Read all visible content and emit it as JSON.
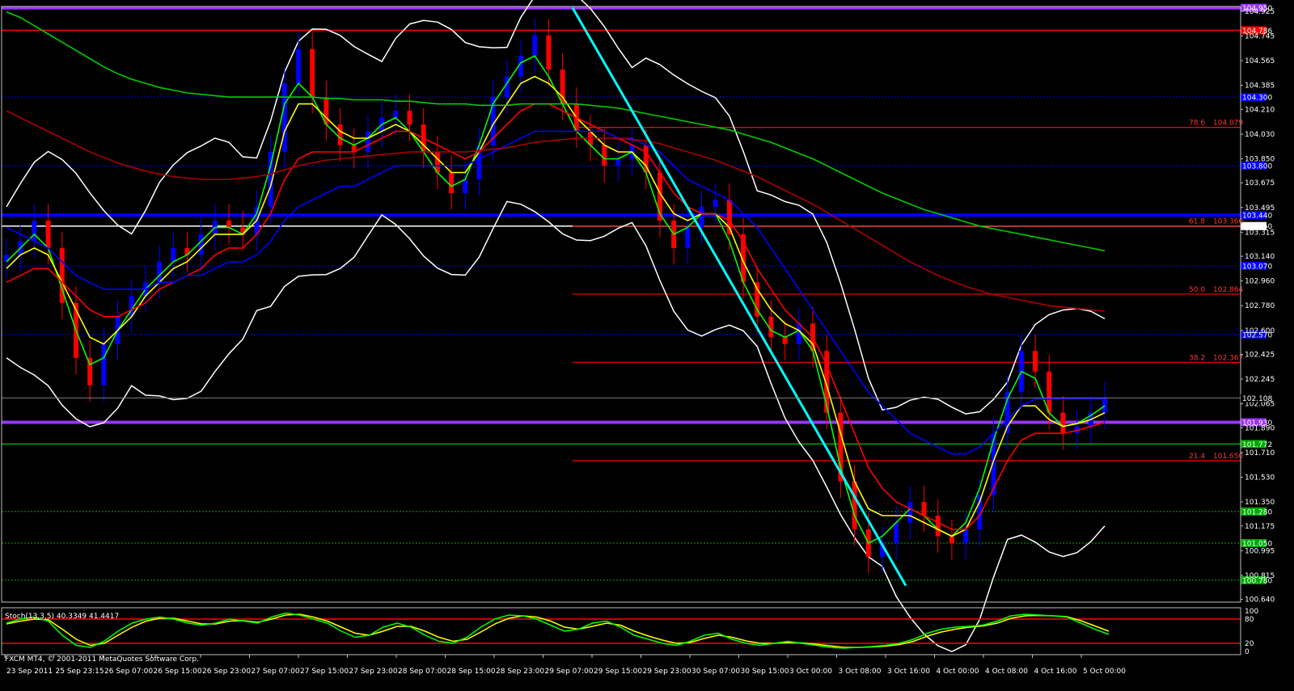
{
  "window": {
    "copyright": "FXCM MT4, © 2001-2011 MetaQuotes Software Corp."
  },
  "colors": {
    "background": "#000000",
    "axis": "#c0c0c0",
    "bull_candle": "#0000ff",
    "bear_candle": "#ff0000",
    "ema5": "#00ff00",
    "ema8": "#ffff00",
    "ema21": "#ff0000",
    "ema55": "#0000ff",
    "ema200": "#00cc00",
    "ema365": "#aa0000",
    "bollinger": "#ffffff",
    "trendline": "#00ffff",
    "pivot_major": "#9933ff",
    "stoch_main": "#00ff00",
    "stoch_signal": "#ffff00"
  },
  "chart_data": [
    {
      "type": "candlestick",
      "price_axis": {
        "labels": [
          "104.925",
          "104.745",
          "104.565",
          "104.385",
          "104.210",
          "104.030",
          "103.850",
          "103.675",
          "103.495",
          "103.315",
          "103.140",
          "102.960",
          "102.780",
          "102.600",
          "102.425",
          "102.245",
          "102.065",
          "101.890",
          "101.710",
          "101.530",
          "101.350",
          "101.175",
          "100.995",
          "100.815",
          "100.640"
        ],
        "range": [
          100.62,
          104.96
        ]
      },
      "time_axis": {
        "labels": [
          "23 Sep 2011",
          "25 Sep 23:15",
          "26 Sep 07:00",
          "26 Sep 15:00",
          "26 Sep 23:00",
          "27 Sep 07:00",
          "27 Sep 15:00",
          "27 Sep 23:00",
          "28 Sep 07:00",
          "28 Sep 15:00",
          "28 Sep 23:00",
          "29 Sep 07:00",
          "29 Sep 15:00",
          "29 Sep 23:00",
          "30 Sep 07:00",
          "30 Sep 15:00",
          "3 Oct 00:00",
          "3 Oct 08:00",
          "3 Oct 16:00",
          "4 Oct 00:00",
          "4 Oct 08:00",
          "4 Oct 16:00",
          "5 Oct 00:00"
        ]
      },
      "current_price": "102.108",
      "levels": [
        {
          "price": 104.95,
          "label": "104.950",
          "color": "#9933ff",
          "style": "solid-thick"
        },
        {
          "price": 104.786,
          "label": "104.786",
          "color": "#ff0000",
          "style": "solid"
        },
        {
          "price": 104.3,
          "label": "104.300",
          "color": "#0000ff",
          "style": "dotted"
        },
        {
          "price": 103.8,
          "label": "103.800",
          "color": "#0000ff",
          "style": "dotted"
        },
        {
          "price": 103.44,
          "label": "103.440",
          "color": "#0000ff",
          "style": "solid-thick"
        },
        {
          "price": 103.36,
          "label": "103.360",
          "color": "#ffffff",
          "style": "solid"
        },
        {
          "price": 103.07,
          "label": "103.070",
          "color": "#0000ff",
          "style": "dotted"
        },
        {
          "price": 102.57,
          "label": "102.570",
          "color": "#0000ff",
          "style": "dotted"
        },
        {
          "price": 101.93,
          "label": "101.930",
          "color": "#9933ff",
          "style": "solid-thick"
        },
        {
          "price": 101.772,
          "label": "101.772",
          "color": "#00aa00",
          "style": "solid"
        },
        {
          "price": 101.28,
          "label": "101.280",
          "color": "#00aa00",
          "style": "dotted"
        },
        {
          "price": 101.05,
          "label": "101.050",
          "color": "#00aa00",
          "style": "dotted"
        },
        {
          "price": 100.78,
          "label": "100.780",
          "color": "#00aa00",
          "style": "dotted"
        }
      ],
      "fibonacci": [
        {
          "ratio": "78.6",
          "price": 104.079,
          "label": "104.079"
        },
        {
          "ratio": "61.8",
          "price": 103.36,
          "label": "103.360"
        },
        {
          "ratio": "50.0",
          "price": 102.864,
          "label": "102.864"
        },
        {
          "ratio": "38.2",
          "price": 102.367,
          "label": "102.367"
        },
        {
          "ratio": "21.4",
          "price": 101.65,
          "label": "101.650"
        }
      ],
      "series": [
        {
          "name": "close",
          "values": [
            103.15,
            103.25,
            103.4,
            103.2,
            102.8,
            102.4,
            102.2,
            102.5,
            102.7,
            102.85,
            102.95,
            103.1,
            103.2,
            103.15,
            103.3,
            103.4,
            103.35,
            103.3,
            103.5,
            103.9,
            104.4,
            104.65,
            104.3,
            104.1,
            103.95,
            103.9,
            104.05,
            104.15,
            104.2,
            104.1,
            103.9,
            103.75,
            103.6,
            103.7,
            103.95,
            104.3,
            104.45,
            104.6,
            104.75,
            104.5,
            104.25,
            104.05,
            103.95,
            103.8,
            103.85,
            103.95,
            103.75,
            103.4,
            103.2,
            103.35,
            103.5,
            103.55,
            103.3,
            102.95,
            102.7,
            102.55,
            102.5,
            102.65,
            102.45,
            102.0,
            101.5,
            101.15,
            100.95,
            101.05,
            101.2,
            101.35,
            101.25,
            101.1,
            101.05,
            101.15,
            101.4,
            101.85,
            102.15,
            102.45,
            102.3,
            102.0,
            101.85,
            101.9,
            102.0,
            102.108
          ]
        },
        {
          "name": "ema5",
          "values": [
            103.1,
            103.2,
            103.3,
            103.2,
            102.9,
            102.6,
            102.35,
            102.4,
            102.6,
            102.75,
            102.9,
            103.0,
            103.1,
            103.15,
            103.25,
            103.35,
            103.35,
            103.3,
            103.45,
            103.8,
            104.25,
            104.4,
            104.3,
            104.1,
            104.0,
            103.95,
            104.0,
            104.1,
            104.15,
            104.05,
            103.9,
            103.75,
            103.65,
            103.7,
            103.95,
            104.25,
            104.4,
            104.55,
            104.6,
            104.45,
            104.25,
            104.05,
            103.95,
            103.85,
            103.85,
            103.9,
            103.75,
            103.45,
            103.3,
            103.35,
            103.45,
            103.45,
            103.25,
            102.95,
            102.75,
            102.6,
            102.55,
            102.6,
            102.45,
            102.05,
            101.6,
            101.25,
            101.05,
            101.1,
            101.2,
            101.3,
            101.25,
            101.15,
            101.1,
            101.2,
            101.45,
            101.8,
            102.1,
            102.3,
            102.25,
            102.0,
            101.9,
            101.92,
            101.98,
            102.05
          ]
        },
        {
          "name": "ema8",
          "values": [
            103.05,
            103.15,
            103.2,
            103.15,
            102.95,
            102.75,
            102.55,
            102.5,
            102.6,
            102.7,
            102.85,
            102.95,
            103.05,
            103.1,
            103.2,
            103.3,
            103.3,
            103.3,
            103.4,
            103.65,
            104.05,
            104.25,
            104.25,
            104.15,
            104.05,
            104.0,
            104.0,
            104.05,
            104.1,
            104.05,
            103.95,
            103.85,
            103.75,
            103.75,
            103.9,
            104.1,
            104.25,
            104.4,
            104.45,
            104.4,
            104.3,
            104.15,
            104.05,
            103.95,
            103.9,
            103.9,
            103.8,
            103.6,
            103.45,
            103.4,
            103.45,
            103.45,
            103.35,
            103.1,
            102.9,
            102.75,
            102.65,
            102.6,
            102.5,
            102.2,
            101.85,
            101.5,
            101.3,
            101.25,
            101.25,
            101.25,
            101.2,
            101.15,
            101.1,
            101.15,
            101.35,
            101.65,
            101.9,
            102.05,
            102.05,
            101.95,
            101.9,
            101.92,
            101.95,
            102.0
          ]
        },
        {
          "name": "ema21",
          "values": [
            102.95,
            103.0,
            103.05,
            103.05,
            102.95,
            102.85,
            102.75,
            102.7,
            102.7,
            102.75,
            102.8,
            102.9,
            102.95,
            103.0,
            103.05,
            103.15,
            103.2,
            103.2,
            103.3,
            103.45,
            103.7,
            103.85,
            103.9,
            103.9,
            103.9,
            103.9,
            103.95,
            104.0,
            104.05,
            104.05,
            104.0,
            103.95,
            103.9,
            103.85,
            103.9,
            104.0,
            104.1,
            104.2,
            104.25,
            104.25,
            104.2,
            104.15,
            104.1,
            104.05,
            104.0,
            103.95,
            103.9,
            103.75,
            103.6,
            103.5,
            103.45,
            103.45,
            103.4,
            103.25,
            103.05,
            102.9,
            102.75,
            102.65,
            102.55,
            102.35,
            102.1,
            101.85,
            101.6,
            101.45,
            101.35,
            101.3,
            101.25,
            101.2,
            101.15,
            101.15,
            101.25,
            101.45,
            101.65,
            101.8,
            101.85,
            101.85,
            101.85,
            101.87,
            101.9,
            101.93
          ]
        },
        {
          "name": "ema55",
          "values": [
            103.35,
            103.3,
            103.25,
            103.2,
            103.1,
            103.0,
            102.95,
            102.9,
            102.9,
            102.9,
            102.9,
            102.95,
            102.95,
            103.0,
            103.0,
            103.05,
            103.1,
            103.1,
            103.15,
            103.25,
            103.4,
            103.5,
            103.55,
            103.6,
            103.65,
            103.65,
            103.7,
            103.75,
            103.8,
            103.8,
            103.8,
            103.8,
            103.8,
            103.8,
            103.85,
            103.9,
            103.95,
            104.0,
            104.05,
            104.05,
            104.05,
            104.05,
            104.05,
            104.05,
            104.0,
            104.0,
            103.95,
            103.9,
            103.8,
            103.7,
            103.65,
            103.6,
            103.55,
            103.45,
            103.35,
            103.2,
            103.05,
            102.9,
            102.75,
            102.6,
            102.45,
            102.3,
            102.15,
            102.05,
            101.95,
            101.85,
            101.8,
            101.75,
            101.7,
            101.7,
            101.75,
            101.85,
            101.95,
            102.05,
            102.1,
            102.1,
            102.1,
            102.1,
            102.1,
            102.1
          ]
        },
        {
          "name": "ema200",
          "values": [
            104.92,
            104.88,
            104.82,
            104.76,
            104.7,
            104.64,
            104.58,
            104.52,
            104.47,
            104.43,
            104.4,
            104.37,
            104.35,
            104.33,
            104.32,
            104.31,
            104.3,
            104.3,
            104.3,
            104.3,
            104.3,
            104.3,
            104.3,
            104.29,
            104.29,
            104.28,
            104.28,
            104.28,
            104.27,
            104.27,
            104.26,
            104.25,
            104.25,
            104.25,
            104.24,
            104.24,
            104.24,
            104.25,
            104.25,
            104.25,
            104.25,
            104.25,
            104.24,
            104.23,
            104.22,
            104.2,
            104.18,
            104.16,
            104.14,
            104.12,
            104.1,
            104.08,
            104.06,
            104.03,
            104.0,
            103.97,
            103.93,
            103.89,
            103.85,
            103.8,
            103.75,
            103.7,
            103.65,
            103.6,
            103.56,
            103.52,
            103.48,
            103.45,
            103.42,
            103.39,
            103.36,
            103.34,
            103.32,
            103.3,
            103.28,
            103.26,
            103.24,
            103.22,
            103.2,
            103.18
          ]
        },
        {
          "name": "ema365",
          "values": [
            104.2,
            104.15,
            104.1,
            104.05,
            104.0,
            103.95,
            103.9,
            103.86,
            103.82,
            103.79,
            103.76,
            103.74,
            103.72,
            103.71,
            103.7,
            103.7,
            103.7,
            103.71,
            103.72,
            103.74,
            103.77,
            103.8,
            103.82,
            103.84,
            103.85,
            103.86,
            103.87,
            103.88,
            103.89,
            103.9,
            103.9,
            103.9,
            103.9,
            103.9,
            103.91,
            103.92,
            103.93,
            103.95,
            103.97,
            103.98,
            103.99,
            104.0,
            104.0,
            104.0,
            104.0,
            103.99,
            103.98,
            103.96,
            103.93,
            103.9,
            103.87,
            103.84,
            103.8,
            103.76,
            103.72,
            103.67,
            103.62,
            103.57,
            103.52,
            103.46,
            103.4,
            103.34,
            103.28,
            103.22,
            103.16,
            103.1,
            103.05,
            103.0,
            102.96,
            102.92,
            102.89,
            102.86,
            102.84,
            102.82,
            102.8,
            102.78,
            102.77,
            102.76,
            102.75,
            102.74
          ]
        }
      ]
    },
    {
      "type": "line",
      "indicator_label": "Stoch(13,3,5) 40.3349 41.4417",
      "y_ticks": [
        "100",
        "80",
        "20",
        "0"
      ],
      "range": [
        0,
        100
      ],
      "levels": [
        80,
        20
      ],
      "series": [
        {
          "name": "main",
          "values": [
            70,
            80,
            85,
            75,
            40,
            15,
            10,
            25,
            50,
            70,
            80,
            85,
            80,
            70,
            65,
            70,
            80,
            75,
            70,
            85,
            95,
            90,
            80,
            70,
            50,
            35,
            40,
            60,
            70,
            60,
            40,
            25,
            20,
            35,
            60,
            80,
            90,
            88,
            80,
            65,
            50,
            55,
            70,
            75,
            60,
            40,
            30,
            20,
            15,
            25,
            40,
            45,
            30,
            20,
            15,
            20,
            25,
            20,
            15,
            10,
            8,
            10,
            12,
            15,
            20,
            30,
            45,
            55,
            60,
            62,
            65,
            75,
            88,
            92,
            90,
            88,
            85,
            70,
            55,
            42
          ]
        },
        {
          "name": "signal",
          "values": [
            68,
            75,
            80,
            78,
            55,
            30,
            15,
            20,
            40,
            60,
            75,
            82,
            82,
            75,
            68,
            68,
            75,
            76,
            72,
            80,
            90,
            92,
            85,
            75,
            60,
            45,
            40,
            50,
            62,
            62,
            50,
            35,
            25,
            30,
            48,
            68,
            82,
            88,
            85,
            75,
            60,
            55,
            62,
            70,
            65,
            50,
            38,
            28,
            20,
            22,
            32,
            40,
            35,
            26,
            20,
            20,
            22,
            21,
            18,
            14,
            10,
            10,
            11,
            13,
            17,
            25,
            38,
            48,
            55,
            60,
            63,
            70,
            82,
            88,
            89,
            88,
            86,
            76,
            63,
            50
          ]
        }
      ]
    }
  ]
}
